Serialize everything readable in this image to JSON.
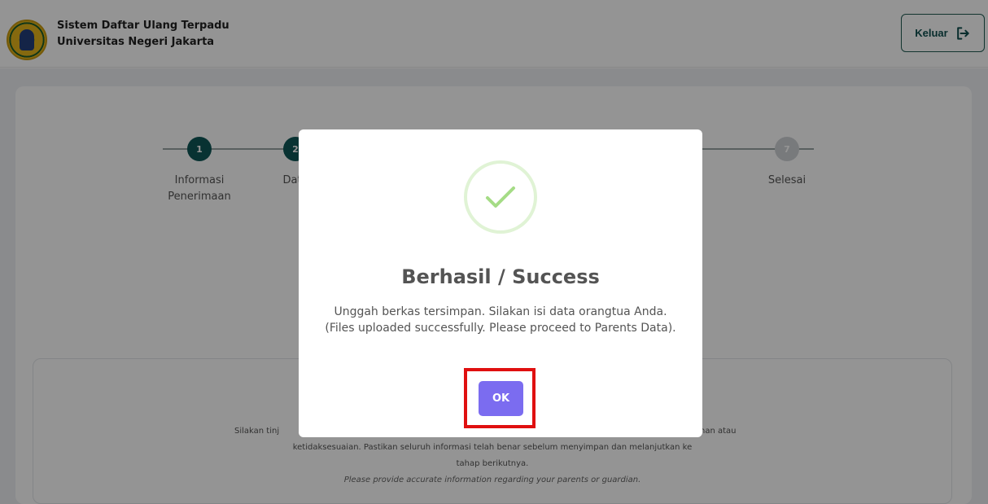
{
  "header": {
    "title_line1": "Sistem Daftar Ulang Terpadu",
    "title_line2": "Universitas Negeri Jakarta",
    "logout_label": "Keluar"
  },
  "stepper": {
    "steps": [
      {
        "number": "1",
        "label_line1": "Informasi",
        "label_line2": "Penerimaan",
        "state": "active"
      },
      {
        "number": "2",
        "label_line1": "Data",
        "label_line2": "",
        "state": "active"
      },
      {
        "number": "7",
        "label_line1": "Selesai",
        "label_line2": "",
        "state": "inactive"
      }
    ],
    "partial_label": "ata"
  },
  "info": {
    "line1_left": "Silakan tinj",
    "line1_right": "han atau",
    "line2": "ketidaksesuaian. Pastikan seluruh informasi telah benar sebelum menyimpan dan melanjutkan ke",
    "line3": "tahap berikutnya.",
    "note": "Please provide accurate information regarding your parents or guardian."
  },
  "modal": {
    "icon": "success-check-icon",
    "title": "Berhasil / Success",
    "message": "Unggah berkas tersimpan. Silakan isi data orangtua Anda. (Files uploaded successfully. Please proceed to Parents Data).",
    "ok_label": "OK"
  },
  "colors": {
    "primary": "#0e5656",
    "ok_button": "#7b6cf0",
    "highlight": "#e01010",
    "success": "#a5dc86"
  }
}
